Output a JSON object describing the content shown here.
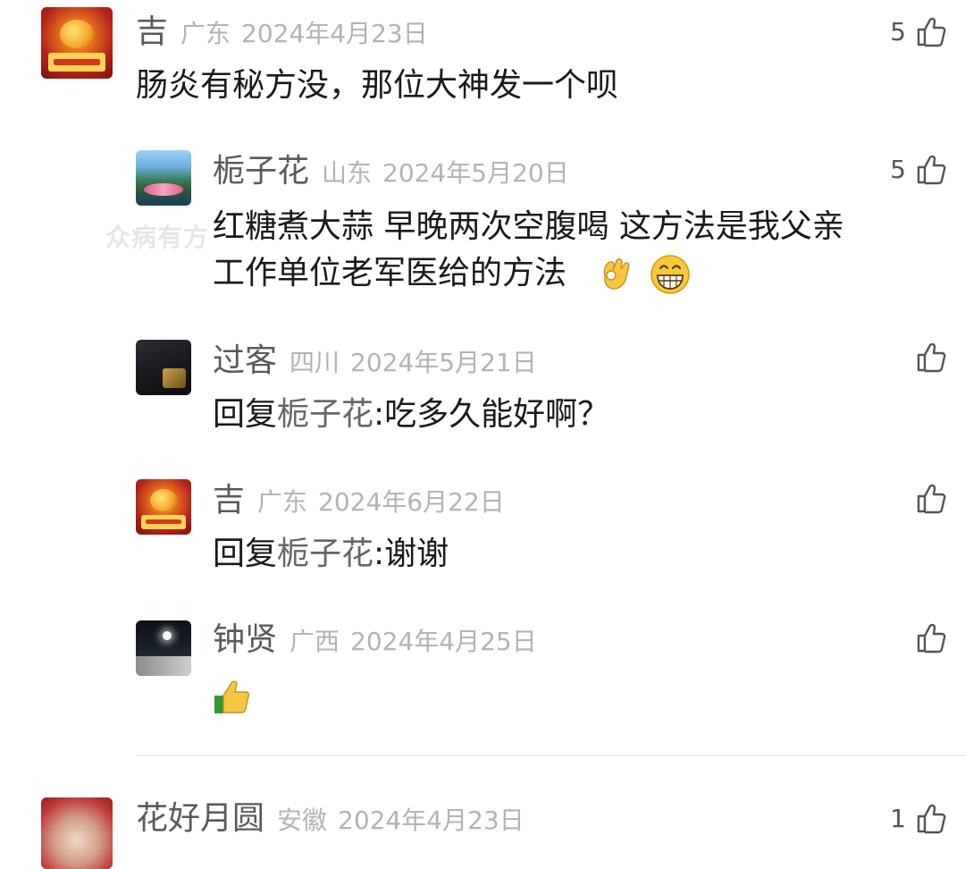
{
  "watermark": "众病有方",
  "comments": [
    {
      "name": "吉",
      "region": "广东",
      "date": "2024年4月23日",
      "likes": "5",
      "text": "肠炎有秘方没，那位大神发一个呗"
    }
  ],
  "replies": [
    {
      "name": "栀子花",
      "region": "山东",
      "date": "2024年5月20日",
      "likes": "5",
      "line1": "红糖煮大蒜 早晚两次空腹喝 这方法是我父亲",
      "line2": "工作单位老军医给的方法",
      "emojis": [
        "ok-hand-emoji",
        "grinning-face-emoji"
      ]
    },
    {
      "name": "过客",
      "region": "四川",
      "date": "2024年5月21日",
      "likes": "",
      "reply_prefix": "回复",
      "reply_target": "栀子花",
      "text": ":吃多久能好啊？"
    },
    {
      "name": "吉",
      "region": "广东",
      "date": "2024年6月22日",
      "likes": "",
      "reply_prefix": "回复",
      "reply_target": "栀子花",
      "text": ":谢谢"
    },
    {
      "name": "钟贤",
      "region": "广西",
      "date": "2024年4月25日",
      "likes": "",
      "emojis": [
        "thumbs-up-emoji"
      ]
    }
  ],
  "next_comment": {
    "name": "花好月圆",
    "region": "安徽",
    "date": "2024年4月23日",
    "likes": "1"
  },
  "colors": {
    "name": "#5a5a5a",
    "meta": "#b3b3b3",
    "text": "#1a1a1a",
    "reply_target": "#666666"
  }
}
